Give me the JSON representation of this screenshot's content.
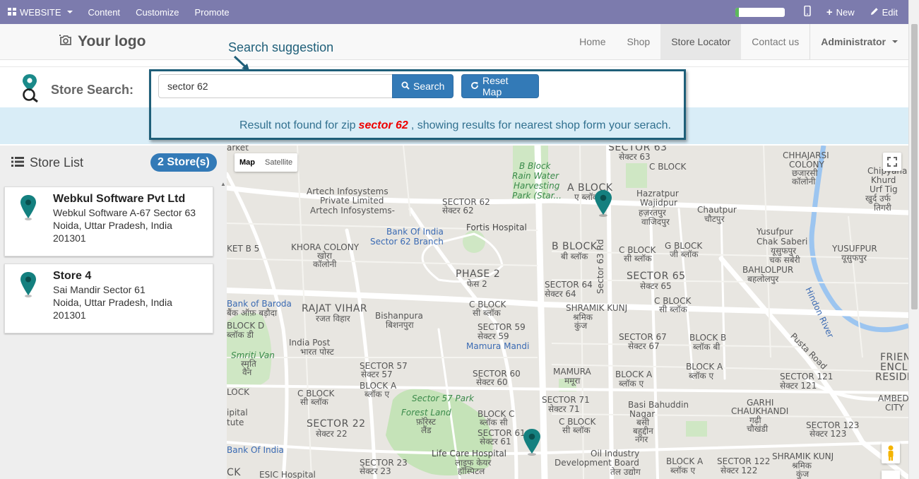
{
  "adminbar": {
    "website_label": "WEBSITE",
    "menu": [
      "Content",
      "Customize",
      "Promote"
    ],
    "new_label": "New",
    "edit_label": "Edit",
    "progress_fraction": 0.08
  },
  "header": {
    "logo_text": "Your logo",
    "nav": [
      "Home",
      "Shop",
      "Store Locator",
      "Contact us"
    ],
    "active_nav": "Store Locator",
    "user_label": "Administrator"
  },
  "annotation": {
    "label": "Search suggestion"
  },
  "search": {
    "label": "Store Search:",
    "value": "sector 62",
    "search_button": "Search",
    "reset_button": "Reset Map"
  },
  "notice": {
    "prefix": "Result not found for zip",
    "zip": "sector 62",
    "suffix": ", showing results for nearest shop form your serach."
  },
  "store_list": {
    "title": "Store List",
    "count_label": "2 Store(s)",
    "stores": [
      {
        "name": "Webkul Software Pvt Ltd",
        "line1": "Webkul Software A-67 Sector 63",
        "line2": "Noida, Uttar Pradesh, India",
        "line3": "201301"
      },
      {
        "name": "Store 4",
        "line1": "Sai Mandir Sector 61",
        "line2": "Noida, Uttar Pradesh, India",
        "line3": "201301"
      }
    ]
  },
  "map": {
    "toggle": [
      "Map",
      "Satellite"
    ],
    "active_toggle": "Map",
    "labels": {
      "sector63": "SECTOR 63",
      "sector63_hi": "सेक्टर 63",
      "artech": "Artech Infosystems",
      "artech2": "Private Limited",
      "artech3": "Artech Infosystems-",
      "bblock_rain": "B Block",
      "rain": "Rain Water",
      "harvest": "Harvesting",
      "park": "Park (Star...",
      "ablock": "A BLOCK",
      "ablock_hi": "ए ब्लॉक",
      "sector62": "SECTOR 62",
      "sector62_hi": "सेक्टर 62",
      "boi": "Bank Of India",
      "boi2": "Sector 62 Branch",
      "fortis": "Fortis Hospital",
      "hazrat": "Hazratpur",
      "wajid": "Wajidpur",
      "hazrat_hi": "हज़रतपुर",
      "wajid_hi": "वाजिदपुर",
      "chautpur": "Chautpur",
      "chautpur_hi": "चौटपुर",
      "chhajarsi": "CHHAJARSI",
      "colony": "COLONY",
      "chhajarsi_hi": "छजारसी",
      "colony_hi": "कॉलोनी",
      "khora": "KHORA COLONY",
      "khora_hi": "खोरा",
      "khora_hi2": "कॉलोनी",
      "phase2": "PHASE 2",
      "phase2_hi": "फेस 2",
      "bblock": "B BLOCK",
      "bblock_hi": "बी ब्लॉक",
      "cblock1": "C BLOCK",
      "cblock1_hi": "सी ब्लॉक",
      "gblock": "G BLOCK",
      "gblock_hi": "जी ब्लॉक",
      "yusufpur": "Yusufpur",
      "chak": "Chak Saberi",
      "yusuf_hi": "यूसुफपुर",
      "chak_hi": "चक सबेरी",
      "yusufpur2": "YUSUFPUR",
      "yusufpur2_hi": "यूसुफपुर",
      "sector64": "SECTOR 64",
      "sector64_hi": "सेक्टर 64",
      "sector65": "SECTOR 65",
      "sector65_hi": "सेक्टर 65",
      "bahlolpur": "BAHLOLPUR",
      "bahlolpur_hi": "बहलोलपुर",
      "bob": "Bank of Baroda",
      "bob_hi": "बैंक ऑफ़ बड़ौदा",
      "rajat": "RAJAT VIHAR",
      "rajat_hi": "रजत विहार",
      "bishan": "Bishanpura",
      "bishan_hi": "बिशनपुरा",
      "cblock2": "C BLOCK",
      "cblock2_hi": "सी ब्लॉक",
      "shramik": "SHRAMIK KUNJ",
      "shramik_hi": "श्रमिक",
      "shramik_hi2": "कुंज",
      "cblock3": "C BLOCK",
      "cblock3_hi": "सी ब्लॉक",
      "hindon": "Hindon River",
      "blockd": "BLOCK D",
      "blockd_hi": "ब्लॉक डी",
      "sector59": "SECTOR 59",
      "sector59_hi": "सेक्टर 59",
      "indiapost": "India Post",
      "indiapost_hi": "भारत पोस्ट",
      "mamura_mandi": "Mamura Mandi",
      "sector67": "SECTOR 67",
      "sector67_hi": "सेक्टर 67",
      "blockb": "BLOCK B",
      "blockb_hi": "ब्लॉक बी",
      "pusta": "Pusta Road",
      "smriti": "Smriti Van",
      "smriti_hi": "स्मृति",
      "smriti_hi2": "वैन",
      "sector57": "SECTOR 57",
      "sector57_hi": "सेक्टर 57",
      "sector60": "SECTOR 60",
      "sector60_hi": "सेक्टर 60",
      "mamura": "MAMURA",
      "mamura_hi": "ममूरा",
      "blocka1": "BLOCK A",
      "blocka1_hi": "ब्लॉक ए",
      "blocka2": "BLOCK A",
      "blocka2_hi": "ब्लॉक ए",
      "sector121": "SECTOR 121",
      "sector121_hi": "सेक्टर 121",
      "friends": "FRIEN",
      "encl": "ENCL",
      "reside": "RESIDE",
      "lock": "LOCK",
      "lock2": "BLOCK A",
      "lock2_hi": "ब्लॉक ए",
      "sec57park": "Sector 57 Park",
      "cblock4": "C BLOCK",
      "cblock4_hi": "सी ब्लॉक",
      "sector71": "SECTOR 71",
      "sector71_hi": "सेक्टर 71",
      "basi": "Basi Bahuddin",
      "nagar": "Nagar",
      "basi_hi": "बसी",
      "basi_hi2": "बहुद्दीन",
      "basi_hi3": "नगर",
      "garhi": "GARHI",
      "chauk": "CHAUKHANDI",
      "garhi_hi": "गढ़ी",
      "chauk_hi": "चौखंडी",
      "ambedka": "AMBEDKA",
      "city": "CITY",
      "forest": "Forest Land",
      "forest_hi": "फ़ॉरेस्ट",
      "forest_hi2": "लैंड",
      "sector22": "SECTOR 22",
      "sector22_hi": "सेक्टर 22",
      "blockc": "BLOCK C",
      "blockc_hi": "ब्लॉक सी",
      "cblock5": "C BLOCK",
      "cblock5_hi": "सी ब्लॉक",
      "sector61": "SECTOR 61",
      "sector61_hi": "सेक्टर 61",
      "sector123": "SECTOR 123",
      "sector123_hi": "सेक्टर 123",
      "ipital": "ipital",
      "tute": "tute",
      "boi3": "Bank Of India",
      "lifecare": "Life Care Hospital",
      "lifecare_hi": "लाइफ केयर",
      "lifecare_hi2": "हॉस्पिटल",
      "oil": "Oil Industry",
      "dev": "Development Board",
      "oil_hi": "तेल उद्योग",
      "blocka3": "BLOCK A",
      "blocka3_hi": "ब्लॉक ए",
      "sector122": "SECTOR 122",
      "sector122_hi": "सेक्टर 122",
      "shramik2": "SHRAMIK KUNJ",
      "shramik2_hi": "श्रमिक",
      "shramik2_hi2": "कुंज",
      "sector23": "SECTOR 23",
      "sector23_hi": "सेक्टर 23",
      "esic": "ESIC Hospital",
      "ck": "CK",
      "market": "arket",
      "kbt5": "KET B 5",
      "chipyana": "Chipyana",
      "khurd": "Khurd",
      "urf": "Urf Tig",
      "chip_hi": "खुर्द उर्फ",
      "chip_hi2": "तिगरी",
      "sector63rd": "Sector 63 Rd",
      "ablock2": "A BLOCK",
      "cblock_top": "C BLOCK"
    }
  }
}
